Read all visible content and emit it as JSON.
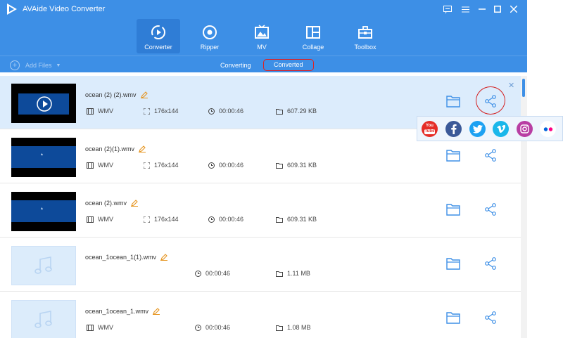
{
  "app": {
    "title": "AVAide Video Converter"
  },
  "nav": [
    {
      "label": "Converter",
      "icon": "converter-icon",
      "active": true
    },
    {
      "label": "Ripper",
      "icon": "ripper-icon"
    },
    {
      "label": "MV",
      "icon": "mv-icon"
    },
    {
      "label": "Collage",
      "icon": "collage-icon"
    },
    {
      "label": "Toolbox",
      "icon": "toolbox-icon"
    }
  ],
  "subbar": {
    "add_files": "Add Files",
    "tabs": [
      "Converting",
      "Converted"
    ],
    "selected_tab": "Converted"
  },
  "files": [
    {
      "name": "ocean (2) (2).wmv",
      "format": "WMV",
      "resolution": "176x144",
      "duration": "00:00:46",
      "size": "607.29 KB",
      "type": "video"
    },
    {
      "name": "ocean (2)(1).wmv",
      "format": "WMV",
      "resolution": "176x144",
      "duration": "00:00:46",
      "size": "609.31 KB",
      "type": "video"
    },
    {
      "name": "ocean (2).wmv",
      "format": "WMV",
      "resolution": "176x144",
      "duration": "00:00:46",
      "size": "609.31 KB",
      "type": "video"
    },
    {
      "name": "ocean_1ocean_1(1).wmv",
      "duration": "00:00:46",
      "size": "1.11 MB",
      "type": "audio"
    },
    {
      "name": "ocean_1ocean_1.wmv",
      "format": "WMV",
      "duration": "00:00:46",
      "size": "1.08 MB",
      "type": "audio"
    }
  ],
  "share": {
    "youtube_text": "You",
    "youtube_text2": "Tube",
    "platforms": [
      "youtube",
      "facebook",
      "twitter",
      "vimeo",
      "instagram",
      "flickr"
    ]
  },
  "colors": {
    "accent": "#3d8fe6",
    "highlight_row": "#dcecfc",
    "annotation": "#d42020"
  }
}
